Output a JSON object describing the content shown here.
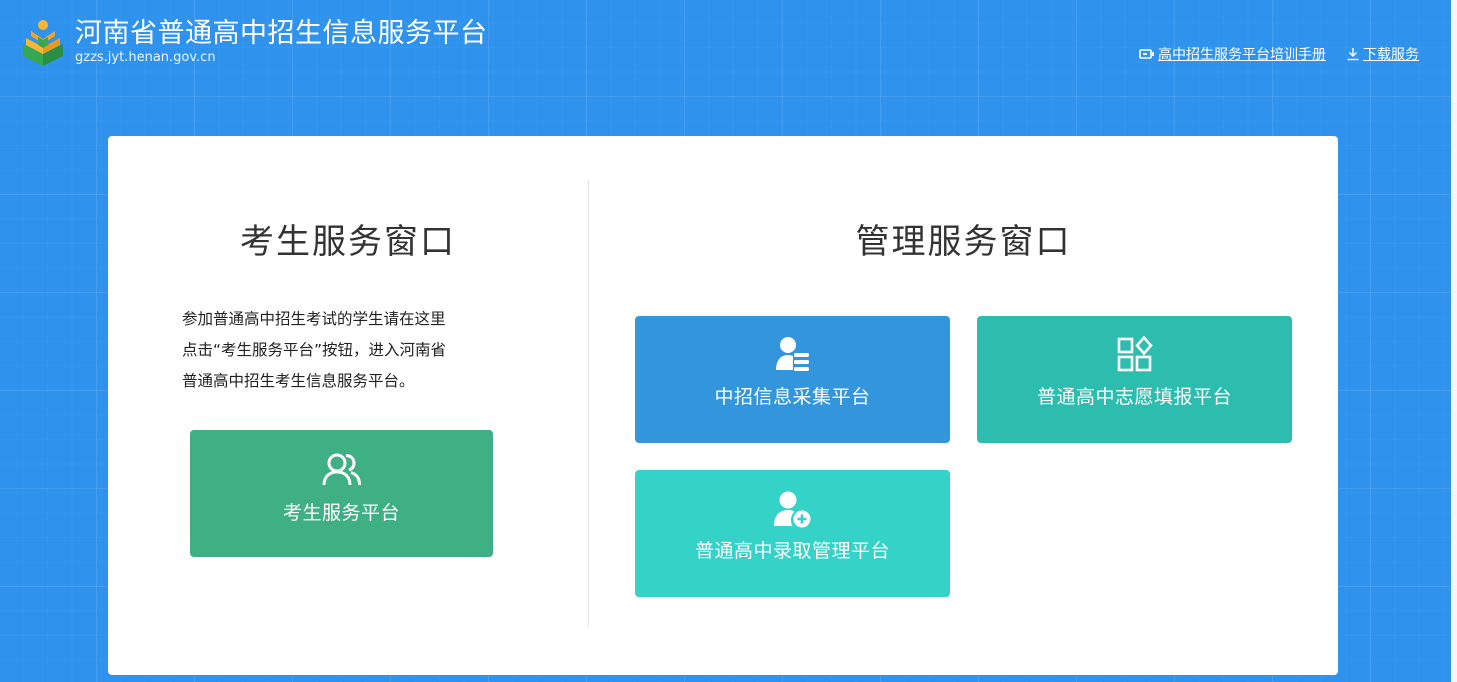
{
  "header": {
    "title": "河南省普通高中招生信息服务平台",
    "domain": "gzzs.jyt.henan.gov.cn",
    "links": [
      {
        "label": "高中招生服务平台培训手册",
        "icon": "manual-icon"
      },
      {
        "label": "下载服务",
        "icon": "download-icon"
      }
    ]
  },
  "student_section": {
    "title": "考生服务窗口",
    "description": [
      "参加普通高中招生考试的学生请在这里",
      "点击“考生服务平台”按钮，进入河南省",
      "普通高中招生考生信息服务平台。"
    ],
    "button": {
      "label": "考生服务平台",
      "icon": "users-icon",
      "color": "#3fb083"
    }
  },
  "admin_section": {
    "title": "管理服务窗口",
    "buttons": [
      {
        "label": "中招信息采集平台",
        "icon": "user-list-icon",
        "color": "#3396dd"
      },
      {
        "label": "普通高中志愿填报平台",
        "icon": "apps-grid-icon",
        "color": "#2dbdae"
      },
      {
        "label": "普通高中录取管理平台",
        "icon": "user-add-icon",
        "color": "#35d2c7"
      }
    ]
  },
  "colors": {
    "background": "#2f93ee",
    "card": "#ffffff"
  }
}
